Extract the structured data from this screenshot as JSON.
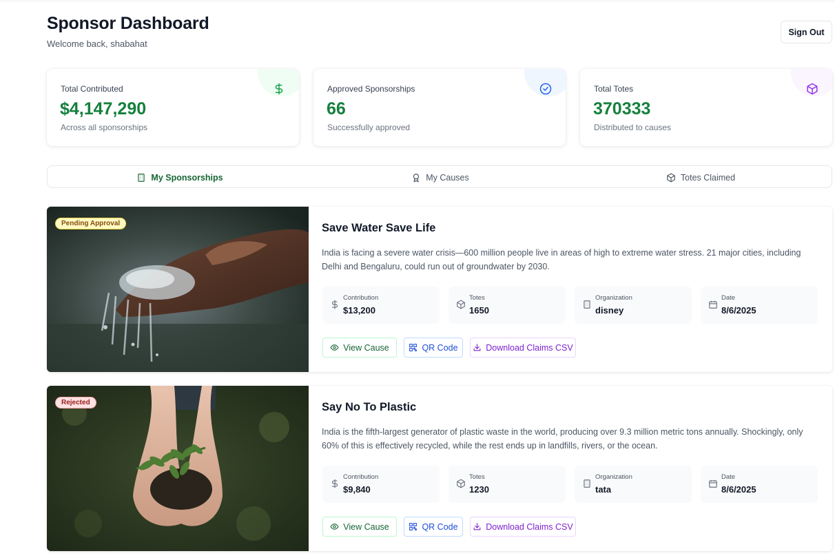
{
  "header": {
    "title": "Sponsor Dashboard",
    "welcome": "Welcome back, shabahat",
    "sign_out": "Sign Out"
  },
  "stats": [
    {
      "label": "Total Contributed",
      "value": "$4,147,290",
      "sub": "Across all sponsorships",
      "icon": "dollar-icon",
      "color": "#16a34a"
    },
    {
      "label": "Approved Sponsorships",
      "value": "66",
      "sub": "Successfully approved",
      "icon": "check-circle-icon",
      "color": "#2563eb"
    },
    {
      "label": "Total Totes",
      "value": "370333",
      "sub": "Distributed to causes",
      "icon": "package-icon",
      "color": "#9333ea"
    }
  ],
  "tabs": [
    {
      "label": "My Sponsorships",
      "icon": "building-icon",
      "active": true
    },
    {
      "label": "My Causes",
      "icon": "award-icon",
      "active": false
    },
    {
      "label": "Totes Claimed",
      "icon": "package-icon",
      "active": false
    }
  ],
  "meta_labels": {
    "contribution": "Contribution",
    "totes": "Totes",
    "organization": "Organization",
    "date": "Date"
  },
  "buttons": {
    "view": "View Cause",
    "qr": "QR Code",
    "csv": "Download Claims CSV"
  },
  "sponsorships": [
    {
      "status": "Pending Approval",
      "title": "Save Water Save Life",
      "description": "India is facing a severe water crisis—600 million people live in areas of high to extreme water stress. 21 major cities, including Delhi and Bengaluru, could run out of groundwater by 2030.",
      "contribution": "$13,200",
      "totes": "1650",
      "organization": "disney",
      "date": "8/6/2025"
    },
    {
      "status": "Rejected",
      "title": "Say No To Plastic",
      "description": "India is the fifth-largest generator of plastic waste in the world, producing over 9.3 million metric tons annually. Shockingly, only 60% of this is effectively recycled, while the rest ends up in landfills, rivers, or the ocean.",
      "contribution": "$9,840",
      "totes": "1230",
      "organization": "tata",
      "date": "8/6/2025"
    }
  ]
}
